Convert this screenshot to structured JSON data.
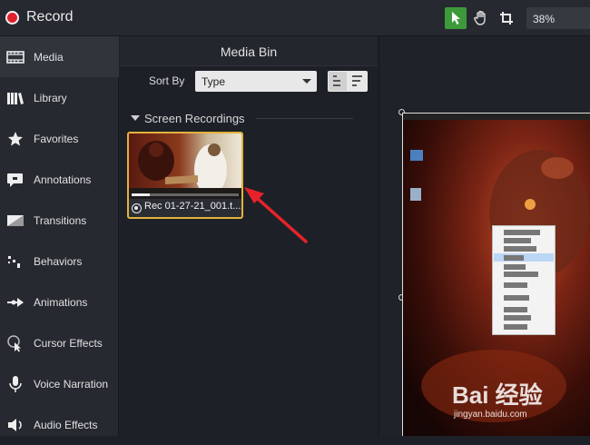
{
  "topbar": {
    "record_label": "Record",
    "zoom_value": "38%",
    "tools": [
      "pointer-icon",
      "hand-icon",
      "crop-icon"
    ]
  },
  "sidebar": {
    "items": [
      {
        "label": "Media",
        "icon": "film-strip-icon"
      },
      {
        "label": "Library",
        "icon": "books-icon"
      },
      {
        "label": "Favorites",
        "icon": "star-icon"
      },
      {
        "label": "Annotations",
        "icon": "speech-bubble-icon"
      },
      {
        "label": "Transitions",
        "icon": "transition-icon"
      },
      {
        "label": "Behaviors",
        "icon": "behaviors-icon"
      },
      {
        "label": "Animations",
        "icon": "animation-arrow-icon"
      },
      {
        "label": "Cursor Effects",
        "icon": "cursor-effects-icon"
      },
      {
        "label": "Voice Narration",
        "icon": "microphone-icon"
      },
      {
        "label": "Audio Effects",
        "icon": "speaker-icon"
      }
    ]
  },
  "media_bin": {
    "title": "Media Bin",
    "sort_by_label": "Sort By",
    "sort_value": "Type",
    "group_title": "Screen Recordings",
    "clip_name": "Rec 01-27-21_001.t..."
  },
  "preview": {
    "watermark": "Bai 经验",
    "watermark_url": "jingyan.baidu.com"
  },
  "colors": {
    "accent_active": "#3d9a3a",
    "record_red": "#e0202c",
    "selection_border": "#e3b23c",
    "annotation_arrow": "#e8222a"
  }
}
